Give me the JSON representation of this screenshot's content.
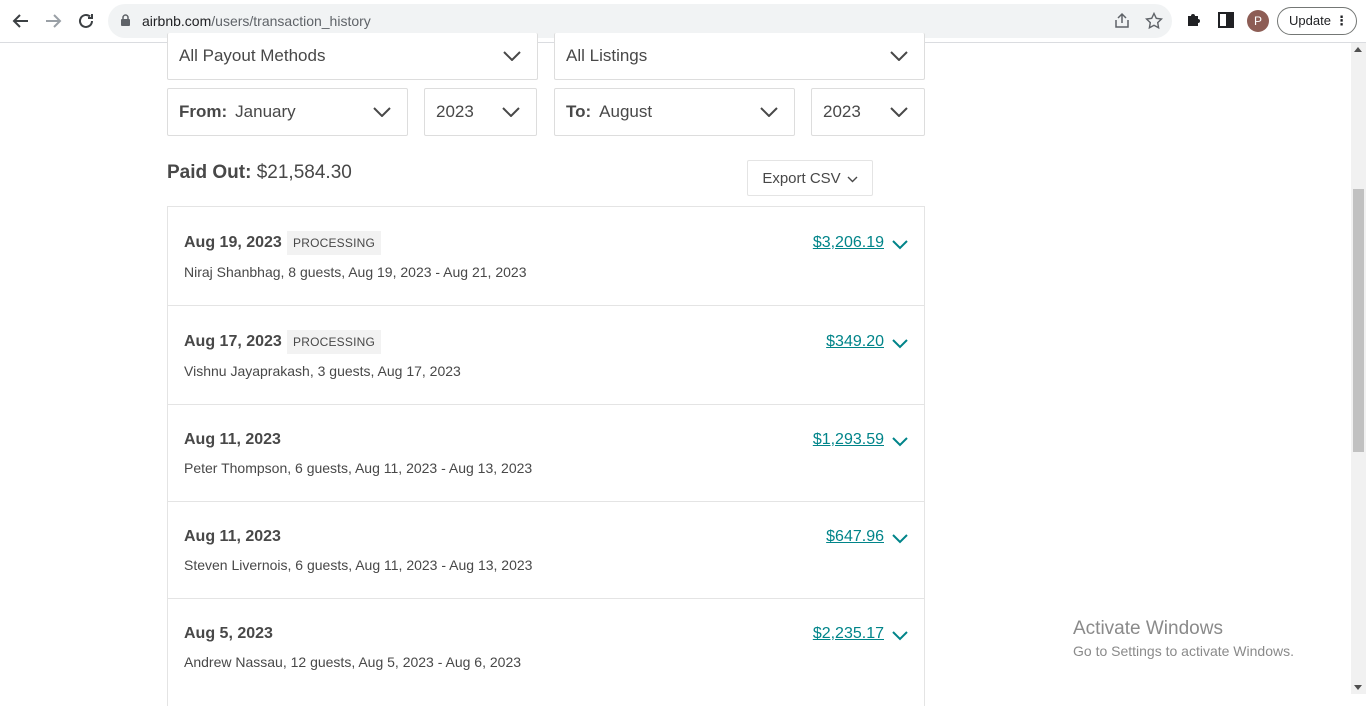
{
  "browser": {
    "url_host": "airbnb.com",
    "url_path": "/users/transaction_history",
    "avatar_letter": "P",
    "update_label": "Update"
  },
  "filters": {
    "payout_methods": "All Payout Methods",
    "listings": "All Listings",
    "from_label": "From:",
    "from_month": "January",
    "from_year": "2023",
    "to_label": "To:",
    "to_month": "August",
    "to_year": "2023"
  },
  "summary": {
    "paid_out_label": "Paid Out:",
    "paid_out_value": "$21,584.30",
    "export_label": "Export CSV"
  },
  "transactions": [
    {
      "date": "Aug 19, 2023",
      "status": "PROCESSING",
      "amount": "$3,206.19",
      "description": "Niraj Shanbhag, 8 guests, Aug 19, 2023 - Aug 21, 2023"
    },
    {
      "date": "Aug 17, 2023",
      "status": "PROCESSING",
      "amount": "$349.20",
      "description": "Vishnu Jayaprakash, 3 guests, Aug 17, 2023"
    },
    {
      "date": "Aug 11, 2023",
      "status": "",
      "amount": "$1,293.59",
      "description": "Peter Thompson, 6 guests, Aug 11, 2023 - Aug 13, 2023"
    },
    {
      "date": "Aug 11, 2023",
      "status": "",
      "amount": "$647.96",
      "description": "Steven Livernois, 6 guests, Aug 11, 2023 - Aug 13, 2023"
    },
    {
      "date": "Aug 5, 2023",
      "status": "",
      "amount": "$2,235.17",
      "description": "Andrew Nassau, 12 guests, Aug 5, 2023 - Aug 6, 2023"
    }
  ],
  "watermark": {
    "line1": "Activate Windows",
    "line2": "Go to Settings to activate Windows."
  },
  "colors": {
    "accent_teal": "#008489",
    "text": "#484848",
    "border": "#e4e4e4"
  }
}
